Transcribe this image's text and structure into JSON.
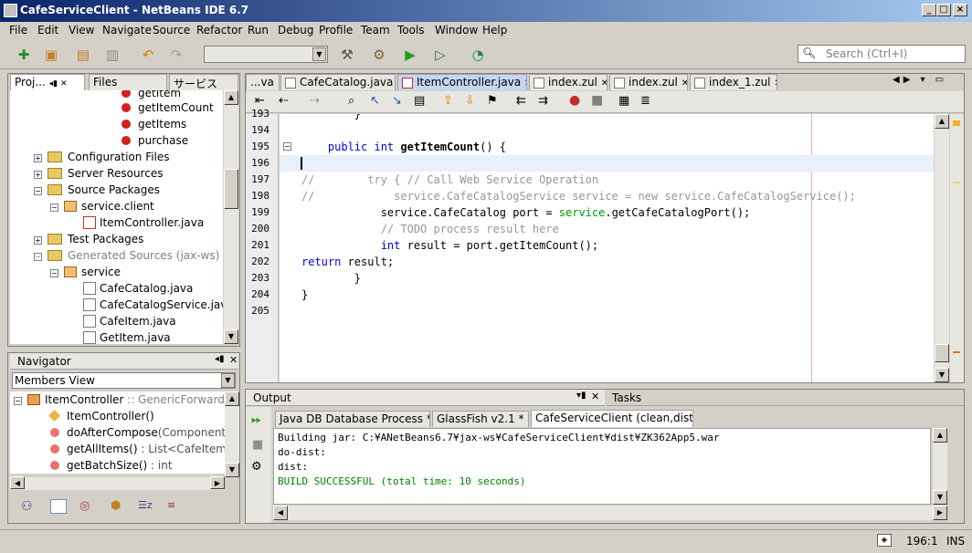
{
  "window": {
    "title": "CafeServiceClient - NetBeans IDE 6.7"
  },
  "menu": [
    "File",
    "Edit",
    "View",
    "Navigate",
    "Source",
    "Refactor",
    "Run",
    "Debug",
    "Profile",
    "Team",
    "Tools",
    "Window",
    "Help"
  ],
  "search": {
    "placeholder": "Search (Ctrl+I)"
  },
  "projects_panel": {
    "tabs": [
      "Proj...",
      "Files",
      "サービス"
    ],
    "tree": [
      {
        "label": "getItem",
        "kind": "method"
      },
      {
        "label": "getItemCount",
        "kind": "method"
      },
      {
        "label": "getItems",
        "kind": "method"
      },
      {
        "label": "purchase",
        "kind": "method"
      },
      {
        "label": "Configuration Files",
        "kind": "folder"
      },
      {
        "label": "Server Resources",
        "kind": "folder"
      },
      {
        "label": "Source Packages",
        "kind": "folder"
      },
      {
        "label": "service.client",
        "kind": "package"
      },
      {
        "label": "ItemController.java",
        "kind": "file"
      },
      {
        "label": "Test Packages",
        "kind": "folder"
      },
      {
        "label": "Generated Sources (jax-ws)",
        "kind": "folder-gray"
      },
      {
        "label": "service",
        "kind": "package"
      },
      {
        "label": "CafeCatalog.java",
        "kind": "file"
      },
      {
        "label": "CafeCatalogService.java",
        "kind": "file"
      },
      {
        "label": "CafeItem.java",
        "kind": "file"
      },
      {
        "label": "GetItem.java",
        "kind": "file"
      }
    ]
  },
  "navigator": {
    "title": "Navigator",
    "view": "Members View",
    "root": "ItemController",
    "root_suffix": ":: GenericForwardComp",
    "members": [
      {
        "name": "ItemController()",
        "type": ""
      },
      {
        "name": "doAfterCompose",
        "type": "(Component winc"
      },
      {
        "name": "getAllItems()",
        "type": ": List<CafeItem>"
      },
      {
        "name": "getBatchSize()",
        "type": ": int"
      }
    ]
  },
  "editor": {
    "tabs": [
      "...va",
      "CafeCatalog.java",
      "ItemController.java",
      "index.zul",
      "index.zul",
      "index_1.zul"
    ],
    "active_tab": "ItemController.java",
    "lines": [
      {
        "num": "193",
        "segments": [
          {
            "t": "        }",
            "c": ""
          }
        ]
      },
      {
        "num": "194",
        "segments": []
      },
      {
        "num": "195",
        "segments": [
          {
            "t": "    ",
            "c": ""
          },
          {
            "t": "public int ",
            "c": "kw"
          },
          {
            "t": "getItemCount",
            "c": "mth"
          },
          {
            "t": "() {",
            "c": ""
          }
        ]
      },
      {
        "num": "196",
        "segments": []
      },
      {
        "num": "197",
        "segments": [
          {
            "t": "//        try { // Call Web Service Operation",
            "c": "cm"
          }
        ]
      },
      {
        "num": "198",
        "segments": [
          {
            "t": "//            service.CafeCatalogService service = new service.CafeCatalogService();",
            "c": "cm"
          }
        ]
      },
      {
        "num": "199",
        "segments": [
          {
            "t": "            service.CafeCatalog port = ",
            "c": ""
          },
          {
            "t": "service",
            "c": "fld"
          },
          {
            "t": ".getCafeCatalogPort();",
            "c": ""
          }
        ]
      },
      {
        "num": "200",
        "segments": [
          {
            "t": "            // TODO process result here",
            "c": "cm"
          }
        ]
      },
      {
        "num": "201",
        "segments": [
          {
            "t": "            ",
            "c": ""
          },
          {
            "t": "int",
            "c": "kw"
          },
          {
            "t": " result = port.getItemCount();",
            "c": ""
          }
        ]
      },
      {
        "num": "202",
        "segments": [
          {
            "t": "return",
            "c": "kw"
          },
          {
            "t": " result;",
            "c": ""
          }
        ]
      },
      {
        "num": "203",
        "segments": [
          {
            "t": "        }",
            "c": ""
          }
        ]
      },
      {
        "num": "204",
        "segments": [
          {
            "t": "}",
            "c": ""
          }
        ]
      },
      {
        "num": "205",
        "segments": []
      }
    ]
  },
  "output": {
    "title": "Output",
    "tasks_title": "Tasks",
    "tabs": [
      "Java DB Database Process *",
      "GlassFish v2.1 *",
      "CafeServiceClient (clean,dist)"
    ],
    "lines": [
      {
        "text": "Building jar: C:¥ANetBeans6.7¥jax-ws¥CafeServiceClient¥dist¥ZK362App5.war",
        "color": "#000000"
      },
      {
        "text": "do-dist:",
        "color": "#000000"
      },
      {
        "text": "dist:",
        "color": "#000000"
      },
      {
        "text": "BUILD SUCCESSFUL (total time: 10 seconds)",
        "color": "#008000"
      }
    ]
  },
  "status": {
    "position": "196:1",
    "mode": "INS"
  }
}
